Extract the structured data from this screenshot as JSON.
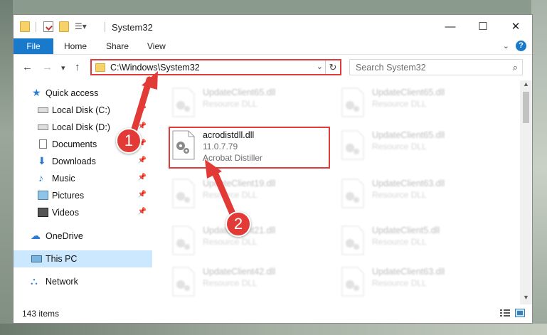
{
  "window": {
    "title": "System32",
    "minimize": "—",
    "maximize": "☐",
    "close": "✕"
  },
  "ribbon": {
    "file_tab": "File",
    "tabs": [
      "Home",
      "Share",
      "View"
    ],
    "help": "?"
  },
  "navigation": {
    "back": "←",
    "forward": "→",
    "recent": "▾",
    "up": "↑",
    "address": "C:\\Windows\\System32",
    "search_placeholder": "Search System32"
  },
  "sidebar": {
    "items": [
      {
        "label": "Quick access",
        "icon": "star-icon"
      },
      {
        "label": "Local Disk (C:)",
        "icon": "drive-icon",
        "pinned": true
      },
      {
        "label": "Local Disk (D:)",
        "icon": "drive-icon",
        "pinned": true
      },
      {
        "label": "Documents",
        "icon": "documents-icon",
        "pinned": true
      },
      {
        "label": "Downloads",
        "icon": "downloads-icon",
        "pinned": true
      },
      {
        "label": "Music",
        "icon": "music-icon",
        "pinned": true
      },
      {
        "label": "Pictures",
        "icon": "pictures-icon",
        "pinned": true
      },
      {
        "label": "Videos",
        "icon": "videos-icon",
        "pinned": true
      },
      {
        "label": "OneDrive",
        "icon": "onedrive-icon"
      },
      {
        "label": "This PC",
        "icon": "pc-icon",
        "selected": true
      },
      {
        "label": "Network",
        "icon": "network-icon"
      }
    ]
  },
  "files": {
    "left_column": [
      {
        "name": "UpdateClient65.dll",
        "type": "Resource DLL"
      },
      {
        "name": "acrodistdll.dll",
        "version": "11.0.7.79",
        "description": "Acrobat Distiller"
      },
      {
        "name": "UpdateClient19.dll",
        "type": "Resource DLL"
      },
      {
        "name": "UpdateClient21.dll",
        "type": "Resource DLL"
      },
      {
        "name": "UpdateClient42.dll",
        "type": "Resource DLL"
      }
    ],
    "right_column": [
      {
        "name": "UpdateClient65.dll",
        "type": "Resource DLL"
      },
      {
        "name": "UpdateClient65.dll",
        "type": "Resource DLL"
      },
      {
        "name": "UpdateClient63.dll",
        "type": "Resource DLL"
      },
      {
        "name": "UpdateClient5.dll",
        "type": "Resource DLL"
      },
      {
        "name": "UpdateClient63.dll",
        "type": "Resource DLL"
      }
    ]
  },
  "status": {
    "item_count": "143 items"
  },
  "annotations": {
    "callout_1": "1",
    "callout_2": "2"
  },
  "colors": {
    "accent": "#1979ca",
    "highlight": "#e03a3a",
    "selection": "#cce8ff"
  }
}
